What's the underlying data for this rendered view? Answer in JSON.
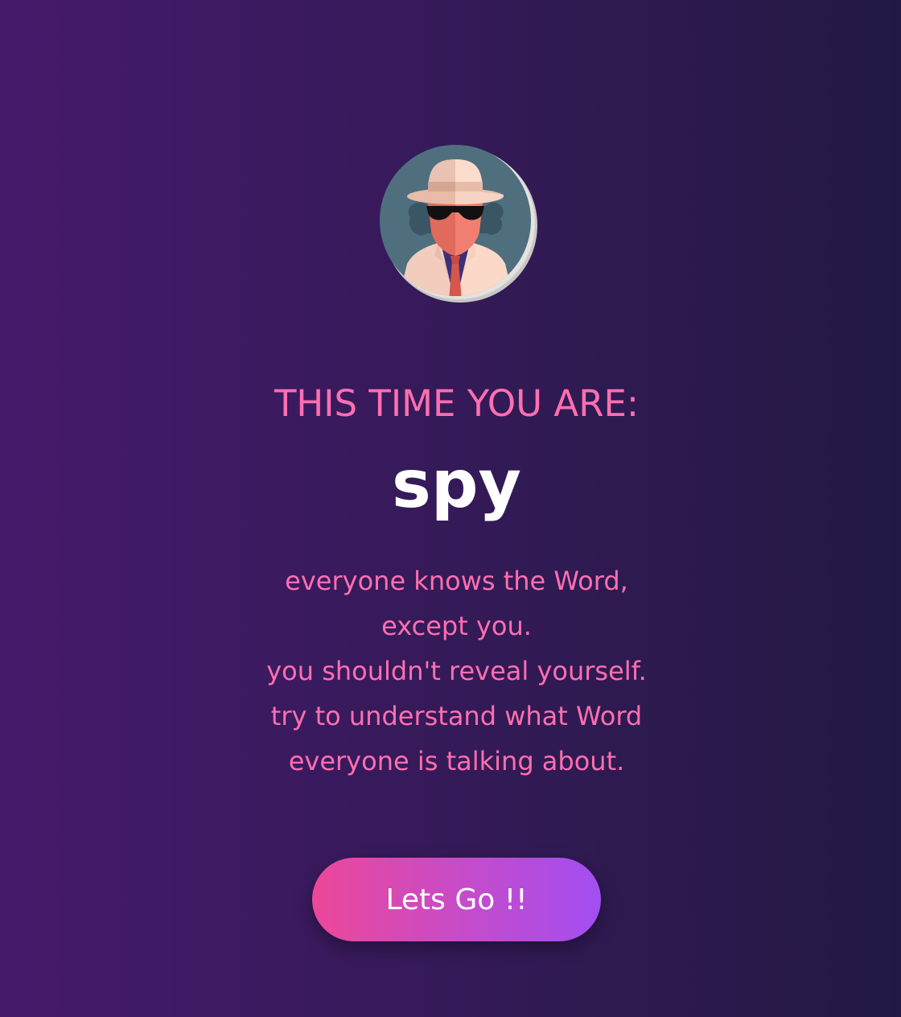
{
  "role": {
    "heading": "THIS TIME YOU ARE:",
    "name": "spy",
    "description_lines": [
      "everyone knows the Word,",
      "except you.",
      "you shouldn't reveal yourself.",
      "try to understand what Word",
      "everyone is talking about."
    ]
  },
  "avatar": {
    "icon": "spy-avatar-icon"
  },
  "actions": {
    "primary_label": "Lets Go !!"
  },
  "colors": {
    "background_start": "#461a6b",
    "background_end": "#231843",
    "accent_pink": "#ff6fb0",
    "button_gradient_start": "#ec4899",
    "button_gradient_end": "#a24ef2",
    "title_white": "#ffffff"
  }
}
